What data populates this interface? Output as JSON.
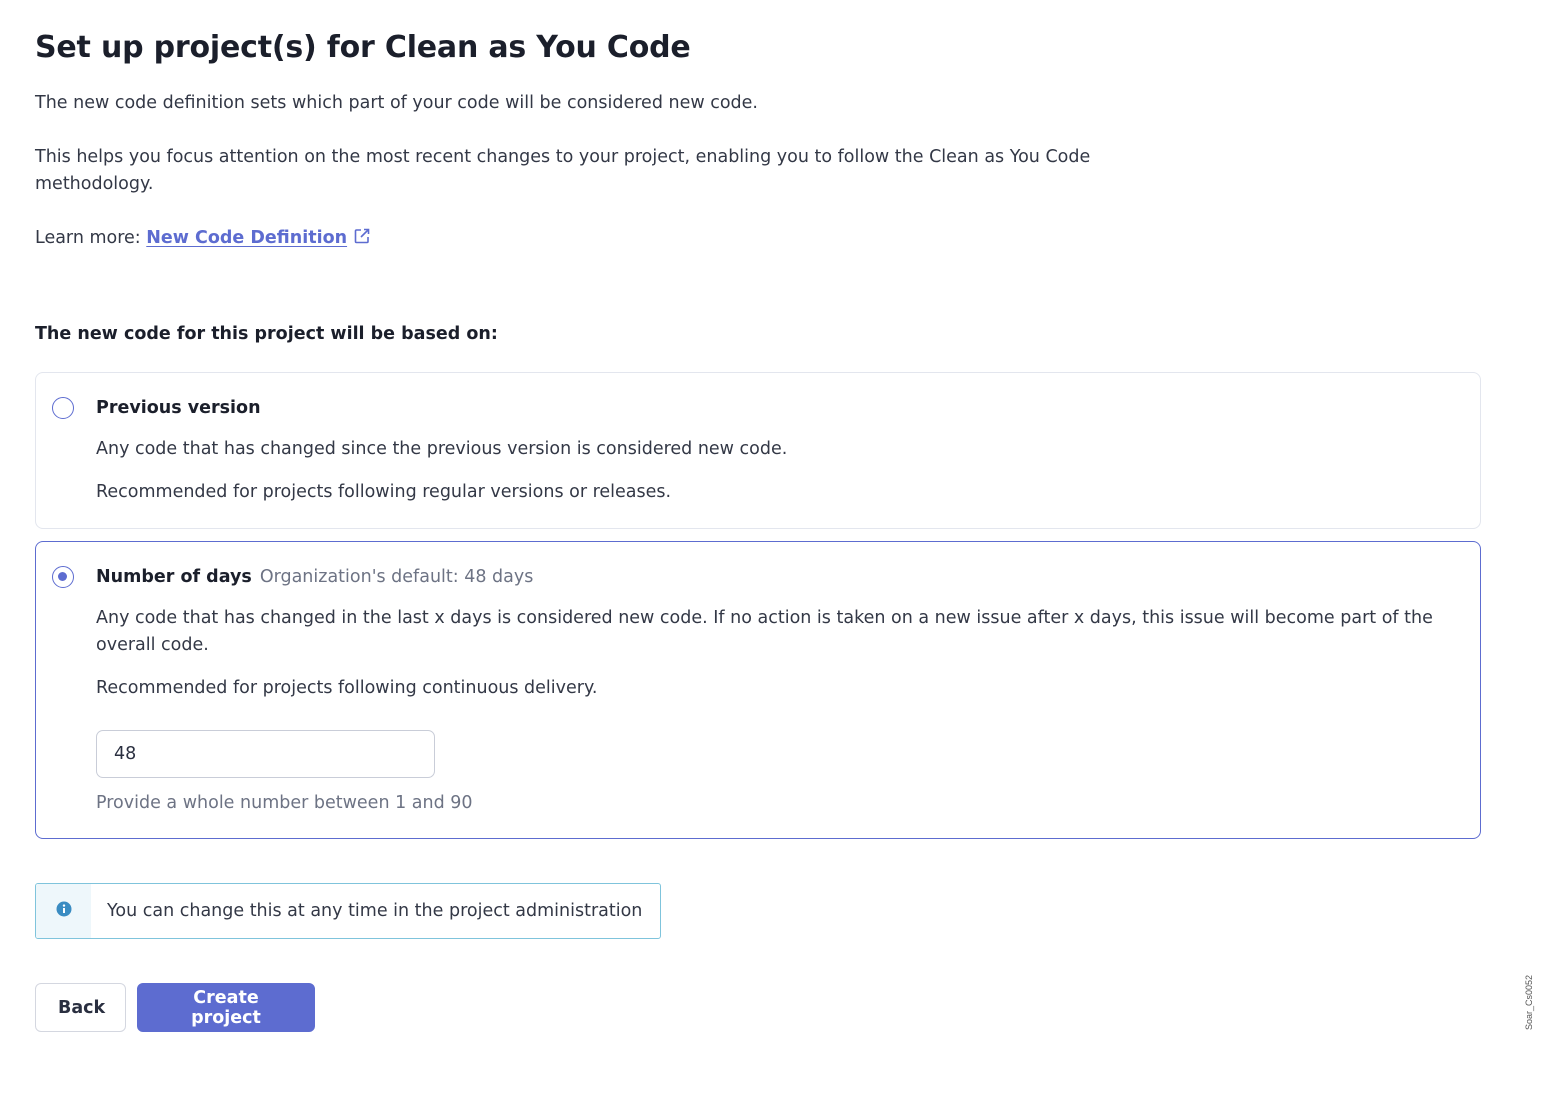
{
  "header": {
    "title": "Set up project(s) for Clean as You Code"
  },
  "intro": {
    "paragraph1": "The new code definition sets which part of your code will be considered new code.",
    "paragraph2": "This helps you focus attention on the most recent changes to your project, enabling you to follow the Clean as You Code methodology.",
    "learn_more_prefix": "Learn more: ",
    "learn_more_link": "New Code Definition"
  },
  "section_label": "The new code for this project will be based on:",
  "options": {
    "previous_version": {
      "title": "Previous version",
      "selected": false,
      "description": "Any code that has changed since the previous version is considered new code.",
      "recommendation": "Recommended for projects following regular versions or releases."
    },
    "number_of_days": {
      "title": "Number of days",
      "subtitle": "Organization's default: 48 days",
      "selected": true,
      "description": "Any code that has changed in the last x days is considered new code. If no action is taken on a new issue after x days, this issue will become part of the overall code.",
      "recommendation": "Recommended for projects following continuous delivery.",
      "input_value": "48",
      "helper": "Provide a whole number between 1 and 90"
    }
  },
  "info": {
    "text": "You can change this at any time in the project administration"
  },
  "buttons": {
    "back": "Back",
    "create": "Create project"
  },
  "watermark": "Soar_Cs0052",
  "colors": {
    "accent": "#5d6cd0",
    "info_border": "#7fc4dc",
    "info_icon": "#3a8cc2"
  }
}
